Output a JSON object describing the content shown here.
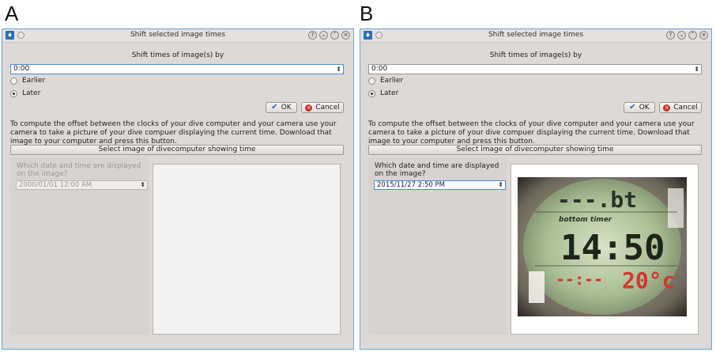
{
  "panels": [
    {
      "letter": "A",
      "window_title": "Shift selected image times",
      "shift_label": "Shift times of image(s) by",
      "time_value": "0:00",
      "radio_earlier": "Earlier",
      "radio_later": "Later",
      "selected_direction": "Later",
      "ok_label": "OK",
      "cancel_label": "Cancel",
      "help_text": "To compute the offset between the clocks of your dive computer and your camera use your camera to take a picture of your dive compuer displaying the current time. Download that image to your computer and press this button.",
      "select_image_label": "Select image of divecomputer showing time",
      "which_label": "Which date and time are displayed on the image?",
      "datetime_value": "2000/01/01 12:00 AM",
      "datetime_enabled": false,
      "image_loaded": false
    },
    {
      "letter": "B",
      "window_title": "Shift selected image times",
      "shift_label": "Shift times of image(s) by",
      "time_value": "0:00",
      "radio_earlier": "Earlier",
      "radio_later": "Later",
      "selected_direction": "Later",
      "ok_label": "OK",
      "cancel_label": "Cancel",
      "help_text": "To compute the offset between the clocks of your dive computer and your camera use your camera to take a picture of your dive compuer displaying the current time. Download that image to your computer and press this button.",
      "select_image_label": "Select image of divecomputer showing time",
      "which_label": "Which date and time are displayed on the image?",
      "datetime_value": "2015/11/27 2:50 PM",
      "datetime_enabled": true,
      "image_loaded": true,
      "dive_computer_display": {
        "top_row": "---.bt",
        "bottom_timer_label": "bottom timer",
        "time": "14:50",
        "bottom_left": "--:--",
        "temperature": "20°c"
      }
    }
  ],
  "colors": {
    "window_border": "#6aa2cf",
    "window_bg": "#ddd9d7",
    "focus_border": "#4a8bd0",
    "ok_icon": "#2f64b0",
    "cancel_icon": "#c8312a",
    "lcd_green": "#9fb58a",
    "lcd_red": "#d2372e"
  },
  "icons": {
    "app": "app-icon",
    "title_buttons": [
      "help-icon",
      "shade-icon",
      "minimize-icon",
      "close-icon"
    ],
    "ok": "checkmark-icon",
    "cancel": "cancel-icon",
    "spinner": "spin-arrows-icon"
  }
}
